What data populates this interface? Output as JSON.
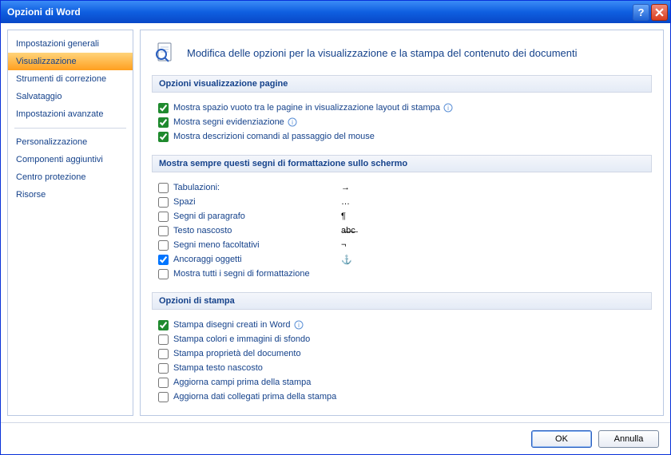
{
  "titlebar": {
    "title": "Opzioni di Word"
  },
  "sidebar": {
    "items": [
      {
        "label": "Impostazioni generali"
      },
      {
        "label": "Visualizzazione"
      },
      {
        "label": "Strumenti di correzione"
      },
      {
        "label": "Salvataggio"
      },
      {
        "label": "Impostazioni avanzate"
      },
      {
        "label": "Personalizzazione"
      },
      {
        "label": "Componenti aggiuntivi"
      },
      {
        "label": "Centro protezione"
      },
      {
        "label": "Risorse"
      }
    ],
    "selected_index": 1
  },
  "header": {
    "text": "Modifica delle opzioni per la visualizzazione e la stampa del contenuto dei documenti"
  },
  "section1": {
    "title": "Opzioni visualizzazione pagine",
    "opts": [
      {
        "label": "Mostra spazio vuoto tra le pagine in visualizzazione layout di stampa",
        "checked": true,
        "info": true
      },
      {
        "label": "Mostra segni evidenziazione",
        "checked": true,
        "info": true
      },
      {
        "label": "Mostra descrizioni comandi al passaggio del mouse",
        "checked": true,
        "info": false
      }
    ]
  },
  "section2": {
    "title": "Mostra sempre questi segni di formattazione sullo schermo",
    "opts": [
      {
        "label": "Tabulazioni:",
        "checked": false,
        "symbol": "→"
      },
      {
        "label": "Spazi",
        "checked": false,
        "symbol": "…"
      },
      {
        "label": "Segni di paragrafo",
        "checked": false,
        "symbol": "¶"
      },
      {
        "label": "Testo nascosto",
        "checked": false,
        "symbol": "a̶b̶c̶"
      },
      {
        "label": "Segni meno facoltativi",
        "checked": false,
        "symbol": "¬"
      },
      {
        "label": "Ancoraggi oggetti",
        "checked": true,
        "symbol": "⚓"
      },
      {
        "label": "Mostra tutti i segni di formattazione",
        "checked": false,
        "symbol": ""
      }
    ]
  },
  "section3": {
    "title": "Opzioni di stampa",
    "opts": [
      {
        "label": "Stampa disegni creati in Word",
        "checked": true,
        "info": true
      },
      {
        "label": "Stampa colori e immagini di sfondo",
        "checked": false,
        "info": false
      },
      {
        "label": "Stampa proprietà del documento",
        "checked": false,
        "info": false
      },
      {
        "label": "Stampa testo nascosto",
        "checked": false,
        "info": false
      },
      {
        "label": "Aggiorna campi prima della stampa",
        "checked": false,
        "info": false
      },
      {
        "label": "Aggiorna dati collegati prima della stampa",
        "checked": false,
        "info": false
      }
    ]
  },
  "footer": {
    "ok": "OK",
    "cancel": "Annulla"
  }
}
